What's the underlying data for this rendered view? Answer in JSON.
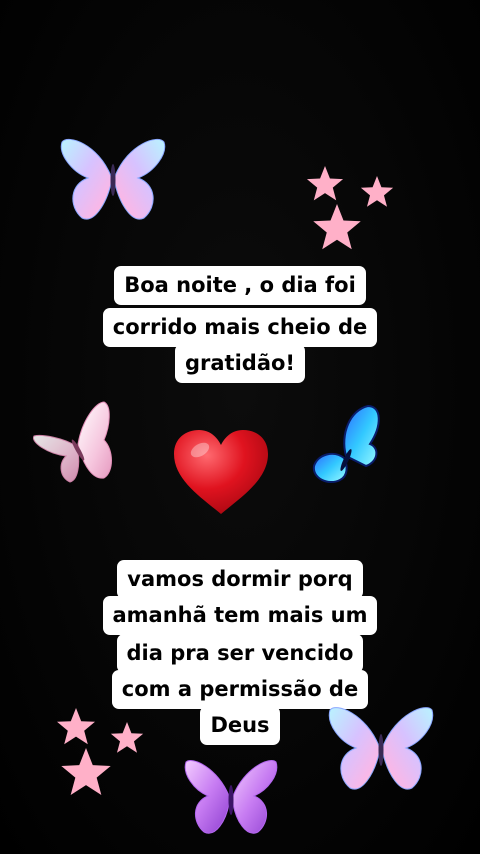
{
  "message_top": {
    "lines": [
      "Boa noite , o dia foi",
      "corrido mais cheio de",
      "gratidão!"
    ]
  },
  "message_bottom": {
    "lines": [
      "vamos dormir porq",
      "amanhã tem mais um",
      "dia pra ser vencido",
      "com a permissão de",
      "Deus"
    ]
  },
  "stickers": {
    "heart": "red-heart-icon",
    "butterflies": [
      "opal-butterfly",
      "pink-butterfly",
      "blue-butterfly",
      "opal-butterfly",
      "purple-butterfly"
    ],
    "stars": "pink-star-cluster"
  },
  "colors": {
    "background": "#000000",
    "caption_bg": "#ffffff",
    "caption_text": "#000000",
    "heart": "#e0131f",
    "star": "#ffb0c8"
  }
}
